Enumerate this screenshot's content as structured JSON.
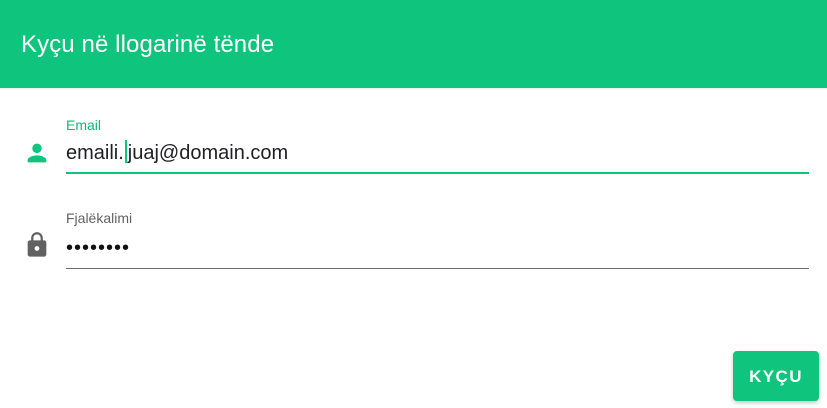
{
  "header": {
    "title": "Kyçu në llogarinë tënde"
  },
  "form": {
    "email": {
      "label": "Email",
      "value_before_caret": "emaili.",
      "value_after_caret": "juaj@domain.com",
      "icon": "person-icon"
    },
    "password": {
      "label": "Fjalëkalimi",
      "value": "••••••••",
      "icon": "lock-icon"
    }
  },
  "actions": {
    "login_label": "KYÇU"
  },
  "colors": {
    "accent": "#0fc47c",
    "label_muted": "#616161",
    "icon_gray": "#616161"
  }
}
